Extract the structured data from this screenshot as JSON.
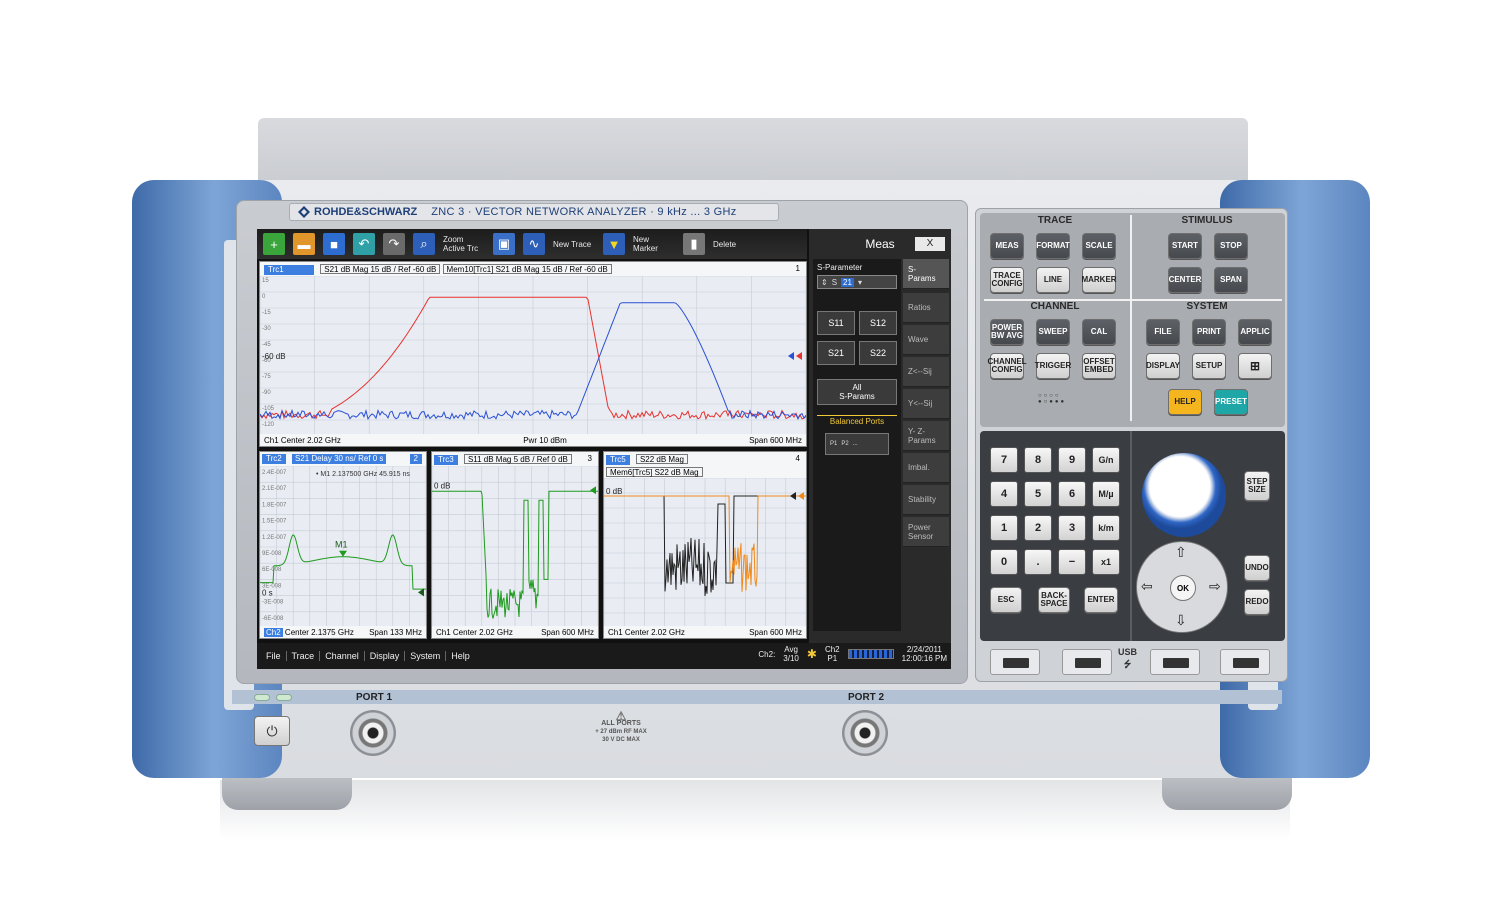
{
  "brand": {
    "logo_text": "ROHDE&SCHWARZ",
    "model_text": "ZNC 3  ·  VECTOR NETWORK ANALYZER  ·  9 kHz ... 3 GHz"
  },
  "toolbar": {
    "zoom_label": "Zoom Active Trc",
    "new_trace_label": "New Trace",
    "new_marker_label": "New Marker",
    "delete_label": "Delete"
  },
  "diagram1": {
    "trace_tag": "Trc1",
    "info": "S21  dB Mag  15 dB / Ref -60 dB",
    "mem_info": "Mem10[Trc1]  S21  dB Mag  15 dB / Ref -60 dB",
    "number": "1",
    "ref_label": "-60 dB",
    "yticks": [
      "15",
      "0",
      "-15",
      "-30",
      "-45",
      "-60",
      "-75",
      "-90",
      "-105",
      "-120",
      "-135"
    ],
    "foot_left": "Ch1  Center  2.02 GHz",
    "foot_mid": "Pwr  10 dBm",
    "foot_right": "Span  600 MHz"
  },
  "diagram2": {
    "trace_tag": "Trc2",
    "info": "S21  Delay  30 ns/ Ref 0 s",
    "tag_num": "2",
    "marker_readout": "• M1  2.137500  GHz   45.915 ns",
    "marker_label": "M1",
    "ref_label": "0 s",
    "yticks": [
      "2.4E-007",
      "2.1E-007",
      "1.8E-007",
      "1.5E-007",
      "1.2E-007",
      "9E-008",
      "6E-008",
      "3E-008",
      "-3E-008",
      "-6E-008"
    ],
    "foot_ch": "Ch2",
    "foot_left": "Center  2.1375 GHz",
    "foot_right": "Span  133 MHz"
  },
  "diagram3": {
    "trace_tag": "Trc3",
    "info": "S11  dB Mag  5 dB / Ref 0 dB",
    "number": "3",
    "ref_label": "0 dB",
    "foot_left": "Ch1  Center  2.02 GHz",
    "foot_right": "Span  600 MHz"
  },
  "diagram4": {
    "trace_tag": "Trc5",
    "info": "S22  dB Mag",
    "mem_info": "Mem6[Trc5]  S22  dB Mag",
    "number": "4",
    "ref_label": "0 dB",
    "foot_left": "Ch1  Center  2.02 GHz",
    "foot_right": "Span  600 MHz"
  },
  "menubar": {
    "items": [
      "File",
      "Trace",
      "Channel",
      "Display",
      "System",
      "Help"
    ],
    "status_ch": "Ch2:",
    "status_avg": "Avg\n3/10",
    "status_ch2": "Ch2\nP1",
    "date": "2/24/2011",
    "time": "12:00:16 PM"
  },
  "meas": {
    "title": "Meas",
    "close": "X",
    "sparam_label": "S-Parameter",
    "sparam_value": "21",
    "sparam_prefix": "S",
    "s11": "S11",
    "s12": "S12",
    "s21": "S21",
    "s22": "S22",
    "all_sparams": "All\nS-Params",
    "balanced_ports": "Balanced Ports",
    "p1": "P1",
    "p2": "P2",
    "dots": "...",
    "tabs": [
      "S-\nParams",
      "Ratios",
      "Wave",
      "Z<--Sij",
      "Y<--Sij",
      "Y- Z-\nParams",
      "Imbal.",
      "Stability",
      "Power\nSensor"
    ]
  },
  "panel": {
    "trace_title": "TRACE",
    "stimulus_title": "STIMULUS",
    "channel_title": "CHANNEL",
    "system_title": "SYSTEM",
    "meas": "MEAS",
    "format": "FORMAT",
    "scale": "SCALE",
    "trace_config": "TRACE\nCONFIG",
    "line": "LINE",
    "marker": "MARKER",
    "start": "START",
    "stop": "STOP",
    "center": "CENTER",
    "span": "SPAN",
    "power_bw_avg": "POWER\nBW AVG",
    "sweep": "SWEEP",
    "cal": "CAL",
    "channel_config": "CHANNEL\nCONFIG",
    "trigger": "TRIGGER",
    "offset_embed": "OFFSET\nEMBED",
    "file": "FILE",
    "print": "PRINT",
    "applic": "APPLIC",
    "display": "DISPLAY",
    "setup": "SETUP",
    "help": "HELP",
    "preset": "PRESET",
    "help_color": "#f5b51e",
    "preset_color": "#1fa6a6",
    "numkeys": [
      "7",
      "8",
      "9",
      "G/n",
      "4",
      "5",
      "6",
      "M/µ",
      "1",
      "2",
      "3",
      "k/m",
      "0",
      ".",
      "−",
      "x1"
    ],
    "esc": "ESC",
    "backspace": "BACK-\nSPACE",
    "enter": "ENTER",
    "step_size": "STEP\nSIZE",
    "undo": "UNDO",
    "redo": "REDO",
    "ok": "OK",
    "usb": "USB"
  },
  "front": {
    "port1": "PORT 1",
    "port2": "PORT 2",
    "all_ports": "ALL PORTS",
    "all_ports_rating": "+ 27 dBm RF MAX\n30 V DC MAX"
  },
  "colors": {
    "trace_red": "#e8322e",
    "trace_blue": "#2a4fd6",
    "trace_green": "#1e9a1e",
    "trace_black": "#222222",
    "trace_orange": "#f08a1c",
    "handle_blue": "#5c86c0"
  }
}
